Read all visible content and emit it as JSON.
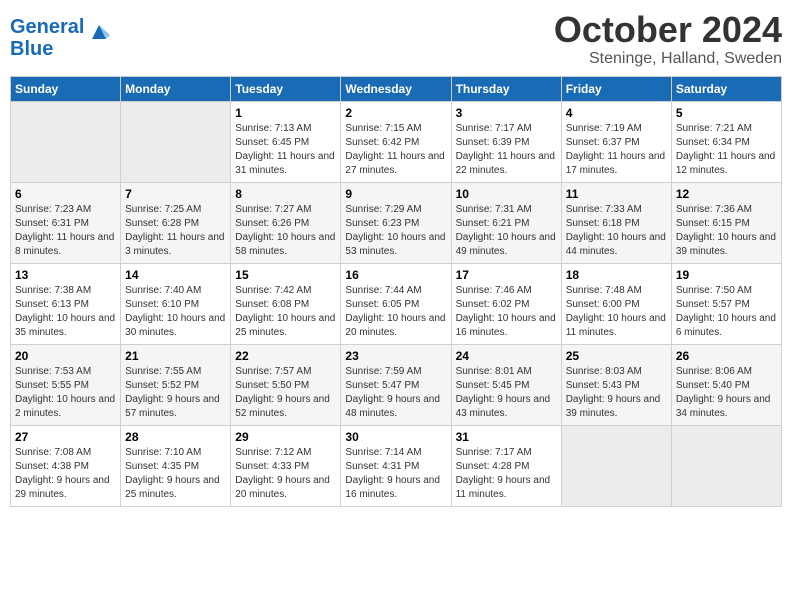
{
  "logo": {
    "line1": "General",
    "line2": "Blue"
  },
  "title": "October 2024",
  "subtitle": "Steninge, Halland, Sweden",
  "weekdays": [
    "Sunday",
    "Monday",
    "Tuesday",
    "Wednesday",
    "Thursday",
    "Friday",
    "Saturday"
  ],
  "weeks": [
    [
      {
        "day": "",
        "detail": ""
      },
      {
        "day": "",
        "detail": ""
      },
      {
        "day": "1",
        "detail": "Sunrise: 7:13 AM\nSunset: 6:45 PM\nDaylight: 11 hours and 31 minutes."
      },
      {
        "day": "2",
        "detail": "Sunrise: 7:15 AM\nSunset: 6:42 PM\nDaylight: 11 hours and 27 minutes."
      },
      {
        "day": "3",
        "detail": "Sunrise: 7:17 AM\nSunset: 6:39 PM\nDaylight: 11 hours and 22 minutes."
      },
      {
        "day": "4",
        "detail": "Sunrise: 7:19 AM\nSunset: 6:37 PM\nDaylight: 11 hours and 17 minutes."
      },
      {
        "day": "5",
        "detail": "Sunrise: 7:21 AM\nSunset: 6:34 PM\nDaylight: 11 hours and 12 minutes."
      }
    ],
    [
      {
        "day": "6",
        "detail": "Sunrise: 7:23 AM\nSunset: 6:31 PM\nDaylight: 11 hours and 8 minutes."
      },
      {
        "day": "7",
        "detail": "Sunrise: 7:25 AM\nSunset: 6:28 PM\nDaylight: 11 hours and 3 minutes."
      },
      {
        "day": "8",
        "detail": "Sunrise: 7:27 AM\nSunset: 6:26 PM\nDaylight: 10 hours and 58 minutes."
      },
      {
        "day": "9",
        "detail": "Sunrise: 7:29 AM\nSunset: 6:23 PM\nDaylight: 10 hours and 53 minutes."
      },
      {
        "day": "10",
        "detail": "Sunrise: 7:31 AM\nSunset: 6:21 PM\nDaylight: 10 hours and 49 minutes."
      },
      {
        "day": "11",
        "detail": "Sunrise: 7:33 AM\nSunset: 6:18 PM\nDaylight: 10 hours and 44 minutes."
      },
      {
        "day": "12",
        "detail": "Sunrise: 7:36 AM\nSunset: 6:15 PM\nDaylight: 10 hours and 39 minutes."
      }
    ],
    [
      {
        "day": "13",
        "detail": "Sunrise: 7:38 AM\nSunset: 6:13 PM\nDaylight: 10 hours and 35 minutes."
      },
      {
        "day": "14",
        "detail": "Sunrise: 7:40 AM\nSunset: 6:10 PM\nDaylight: 10 hours and 30 minutes."
      },
      {
        "day": "15",
        "detail": "Sunrise: 7:42 AM\nSunset: 6:08 PM\nDaylight: 10 hours and 25 minutes."
      },
      {
        "day": "16",
        "detail": "Sunrise: 7:44 AM\nSunset: 6:05 PM\nDaylight: 10 hours and 20 minutes."
      },
      {
        "day": "17",
        "detail": "Sunrise: 7:46 AM\nSunset: 6:02 PM\nDaylight: 10 hours and 16 minutes."
      },
      {
        "day": "18",
        "detail": "Sunrise: 7:48 AM\nSunset: 6:00 PM\nDaylight: 10 hours and 11 minutes."
      },
      {
        "day": "19",
        "detail": "Sunrise: 7:50 AM\nSunset: 5:57 PM\nDaylight: 10 hours and 6 minutes."
      }
    ],
    [
      {
        "day": "20",
        "detail": "Sunrise: 7:53 AM\nSunset: 5:55 PM\nDaylight: 10 hours and 2 minutes."
      },
      {
        "day": "21",
        "detail": "Sunrise: 7:55 AM\nSunset: 5:52 PM\nDaylight: 9 hours and 57 minutes."
      },
      {
        "day": "22",
        "detail": "Sunrise: 7:57 AM\nSunset: 5:50 PM\nDaylight: 9 hours and 52 minutes."
      },
      {
        "day": "23",
        "detail": "Sunrise: 7:59 AM\nSunset: 5:47 PM\nDaylight: 9 hours and 48 minutes."
      },
      {
        "day": "24",
        "detail": "Sunrise: 8:01 AM\nSunset: 5:45 PM\nDaylight: 9 hours and 43 minutes."
      },
      {
        "day": "25",
        "detail": "Sunrise: 8:03 AM\nSunset: 5:43 PM\nDaylight: 9 hours and 39 minutes."
      },
      {
        "day": "26",
        "detail": "Sunrise: 8:06 AM\nSunset: 5:40 PM\nDaylight: 9 hours and 34 minutes."
      }
    ],
    [
      {
        "day": "27",
        "detail": "Sunrise: 7:08 AM\nSunset: 4:38 PM\nDaylight: 9 hours and 29 minutes."
      },
      {
        "day": "28",
        "detail": "Sunrise: 7:10 AM\nSunset: 4:35 PM\nDaylight: 9 hours and 25 minutes."
      },
      {
        "day": "29",
        "detail": "Sunrise: 7:12 AM\nSunset: 4:33 PM\nDaylight: 9 hours and 20 minutes."
      },
      {
        "day": "30",
        "detail": "Sunrise: 7:14 AM\nSunset: 4:31 PM\nDaylight: 9 hours and 16 minutes."
      },
      {
        "day": "31",
        "detail": "Sunrise: 7:17 AM\nSunset: 4:28 PM\nDaylight: 9 hours and 11 minutes."
      },
      {
        "day": "",
        "detail": ""
      },
      {
        "day": "",
        "detail": ""
      }
    ]
  ]
}
